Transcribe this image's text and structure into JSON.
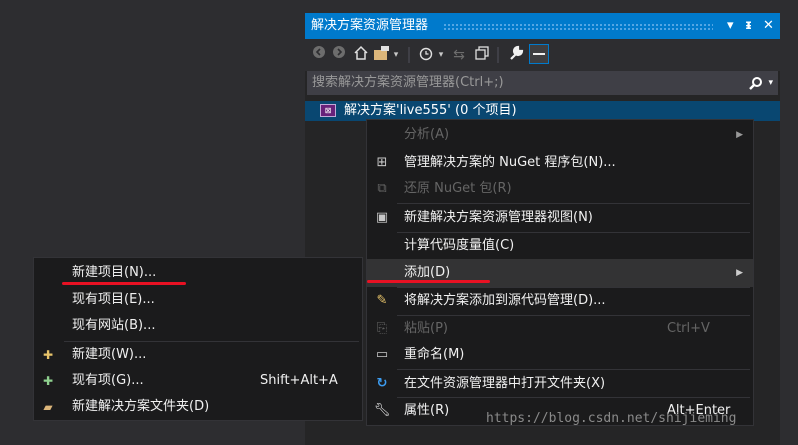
{
  "panel": {
    "title": "解决方案资源管理器",
    "title_buttons": {
      "dropdown": "▾",
      "pin": "ᵻ",
      "close": "✕"
    }
  },
  "toolbar": {
    "icons": [
      "back-icon",
      "forward-icon",
      "home-icon",
      "switch-views-icon",
      "dropdown-icon",
      "pending-changes-icon",
      "dropdown-icon",
      "sync-icon",
      "collapse-all-icon",
      "properties-wrench-icon",
      "preview-icon"
    ]
  },
  "search": {
    "placeholder": "搜索解决方案资源管理器(Ctrl+;)",
    "icon": "search-icon"
  },
  "solution": {
    "label": "解决方案'live555' (0 个项目)",
    "icon": "vs-solution-icon"
  },
  "context_menu": {
    "items": [
      {
        "label": "分析(A)",
        "disabled": true,
        "submenu": true
      },
      {
        "label": "管理解决方案的 NuGet 程序包(N)...",
        "icon": "nuget-icon"
      },
      {
        "label": "还原 NuGet 包(R)",
        "disabled": true,
        "icon": "restore-icon"
      },
      {
        "label": "新建解决方案资源管理器视图(N)",
        "icon": "new-view-icon"
      },
      {
        "label": "计算代码度量值(C)"
      },
      {
        "label": "添加(D)",
        "submenu": true,
        "highlighted": true
      },
      {
        "label": "将解决方案添加到源代码管理(D)...",
        "icon": "source-control-icon"
      },
      {
        "label": "粘贴(P)",
        "shortcut": "Ctrl+V",
        "disabled": true,
        "icon": "paste-icon"
      },
      {
        "label": "重命名(M)",
        "icon": "rename-icon"
      },
      {
        "label": "在文件资源管理器中打开文件夹(X)",
        "icon": "open-folder-icon"
      },
      {
        "label": "属性(R)",
        "shortcut": "Alt+Enter",
        "icon": "wrench-icon"
      }
    ]
  },
  "sub_menu": {
    "items": [
      {
        "label": "新建项目(N)..."
      },
      {
        "label": "现有项目(E)..."
      },
      {
        "label": "现有网站(B)..."
      },
      {
        "label": "新建项(W)...",
        "icon": "new-item-icon"
      },
      {
        "label": "现有项(G)...",
        "shortcut": "Shift+Alt+A",
        "icon": "existing-item-icon"
      },
      {
        "label": "新建解决方案文件夹(D)",
        "icon": "new-folder-icon"
      }
    ]
  },
  "colors": {
    "accent": "#007acc",
    "selection": "#094771",
    "annotation": "#e81123"
  },
  "watermark": "https://blog.csdn.net/shijieming"
}
